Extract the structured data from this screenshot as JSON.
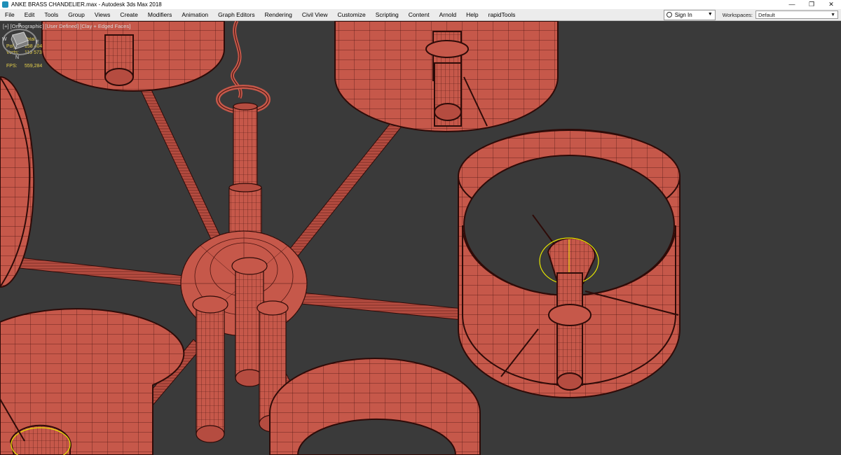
{
  "window": {
    "title": "ANKE BRASS CHANDELIER.max - Autodesk 3ds Max 2018",
    "controls": [
      "—",
      "❐",
      "✕"
    ]
  },
  "menu": {
    "items": [
      "File",
      "Edit",
      "Tools",
      "Group",
      "Views",
      "Create",
      "Modifiers",
      "Animation",
      "Graph Editors",
      "Rendering",
      "Civil View",
      "Customize",
      "Scripting",
      "Content",
      "Arnold",
      "Help",
      "rapidTools"
    ]
  },
  "account": {
    "signin_label": "Sign In"
  },
  "workspaces": {
    "label": "Workspaces:",
    "value": "Default"
  },
  "viewport": {
    "label": "[+] [Orthographic] [User Defined] [Clay + Edged Faces]",
    "stats": {
      "total_label": "Total",
      "polys_label": "Polys:",
      "polys_value": "158 404",
      "verts_label": "Verts:",
      "verts_value": "119 573",
      "fps_label": "FPS:",
      "fps_value": "559,284"
    },
    "viewcube": {
      "top_letter": "S",
      "left_letter": "W",
      "right_letter": "E",
      "bottom_letter": "N"
    }
  },
  "colors": {
    "model": "#c6584a",
    "wire": "#3a0e0a",
    "viewport_bg": "#3a3a3a",
    "stats": "#e8d24b",
    "selection": "#e6e600"
  }
}
